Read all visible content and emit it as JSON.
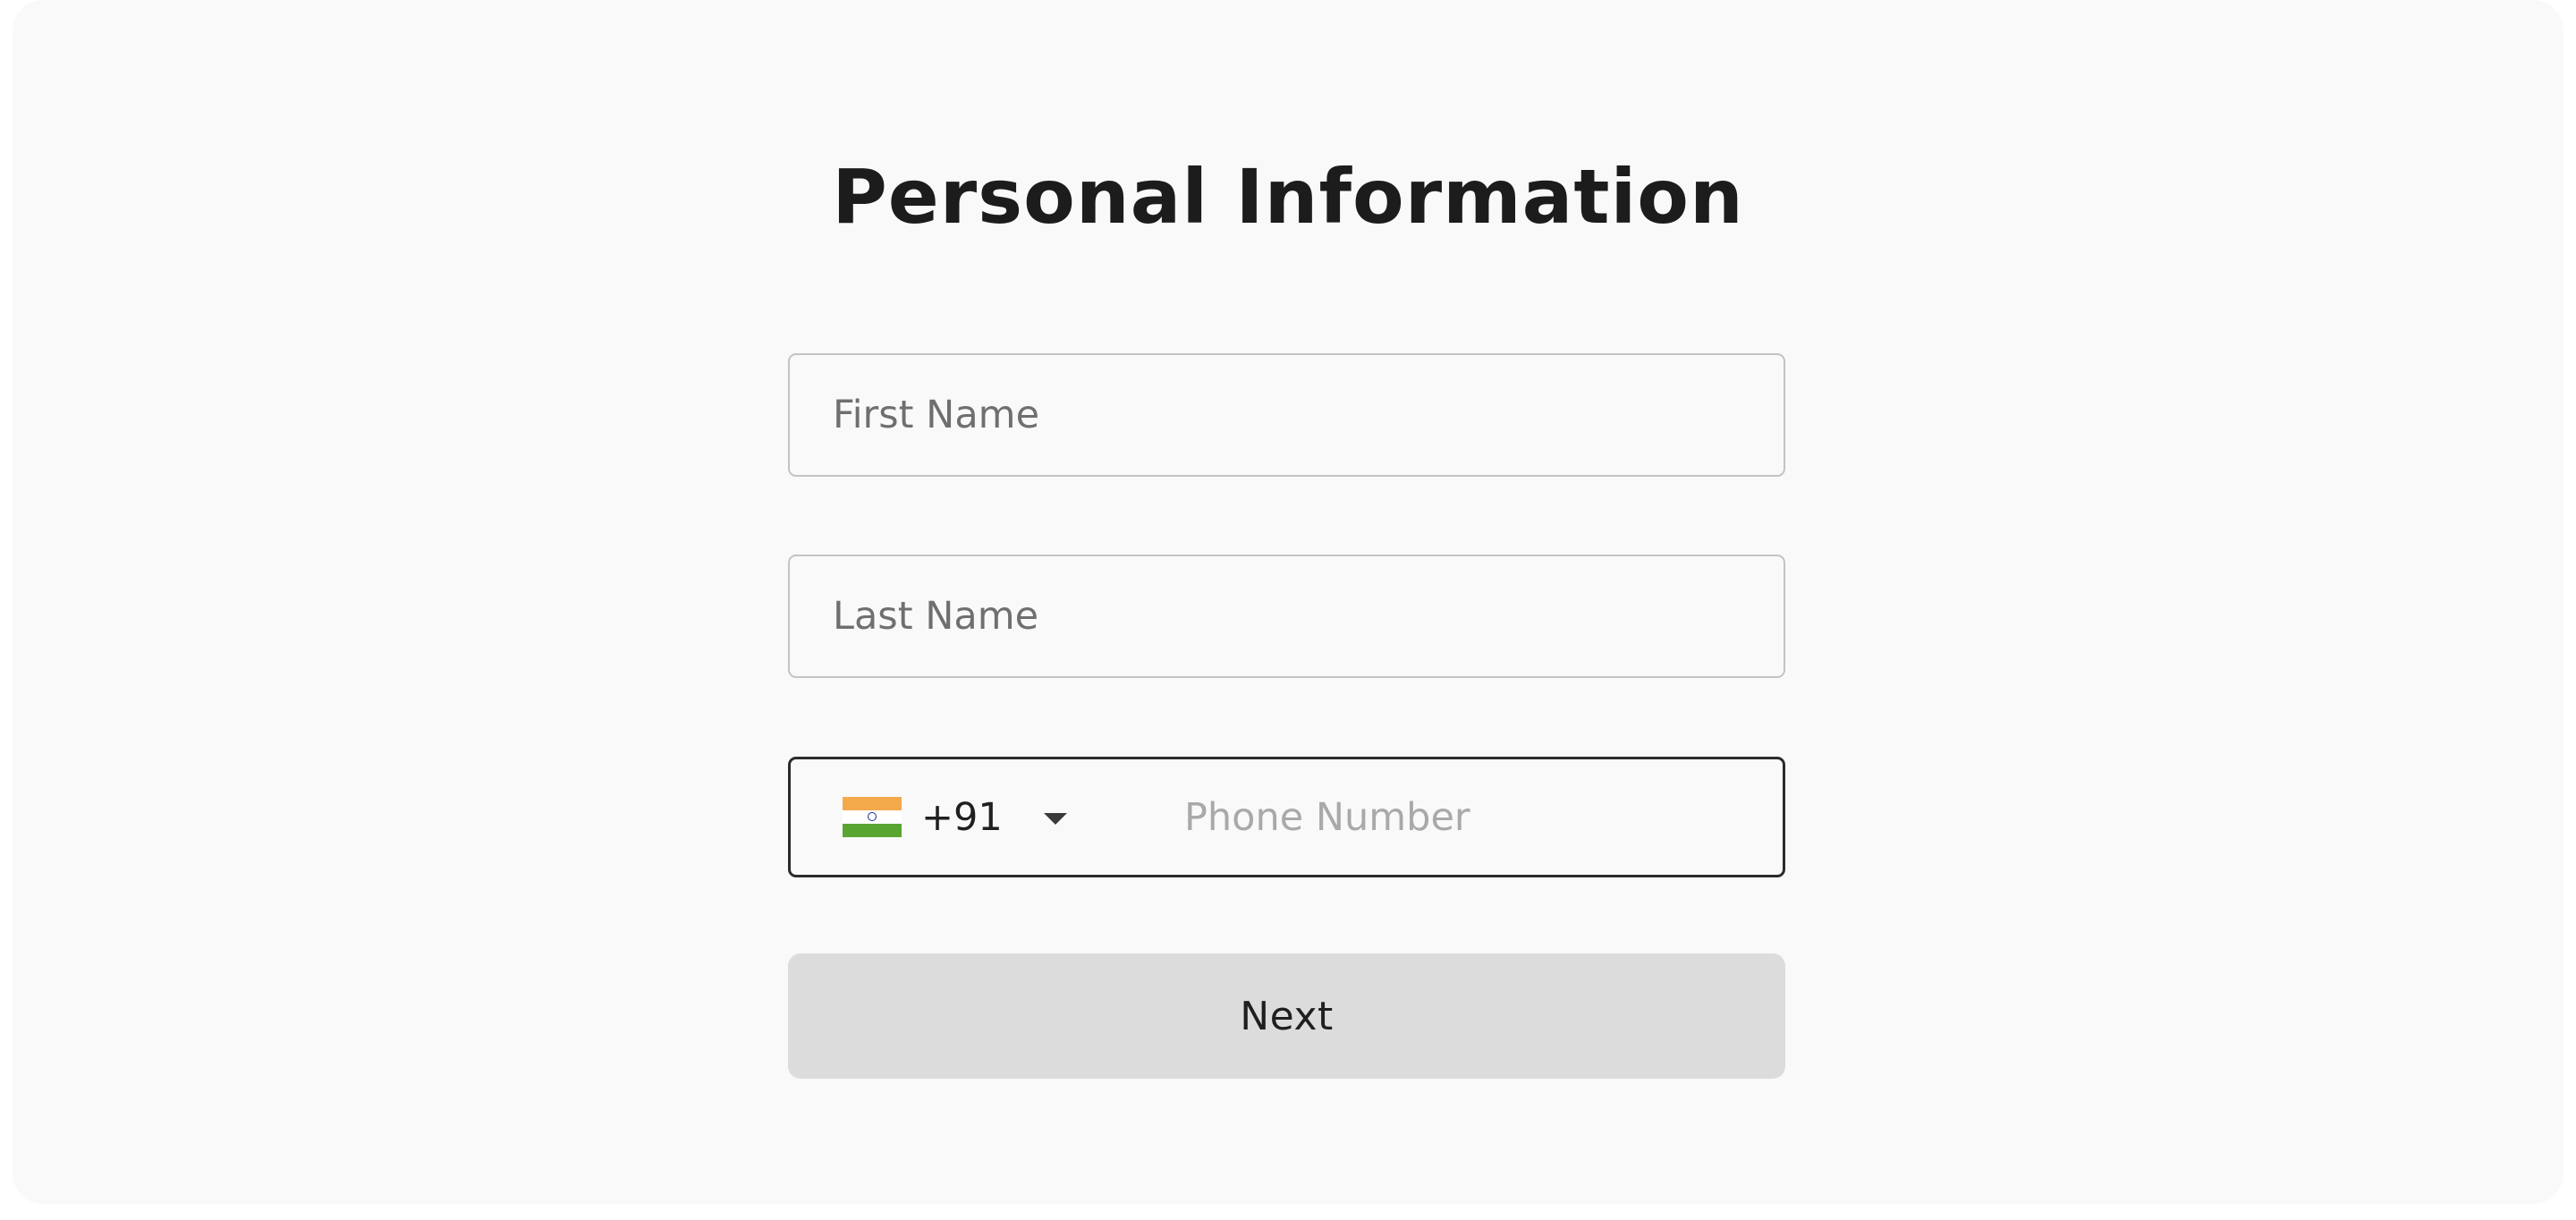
{
  "form": {
    "title": "Personal Information",
    "first_name": {
      "value": "",
      "placeholder": "First Name"
    },
    "last_name": {
      "value": "",
      "placeholder": "Last Name"
    },
    "phone": {
      "country_flag": "india-flag-icon",
      "dial_code": "+91",
      "value": "",
      "placeholder": "Phone Number"
    },
    "next_label": "Next"
  },
  "colors": {
    "card_background": "#f9f9f9",
    "field_border": "#c3c3c3",
    "active_field_border": "#2b2b2b",
    "button_background": "#dcdcdc",
    "flag_saffron": "#f4a94a",
    "flag_white": "#ffffff",
    "flag_green": "#5aa531"
  }
}
